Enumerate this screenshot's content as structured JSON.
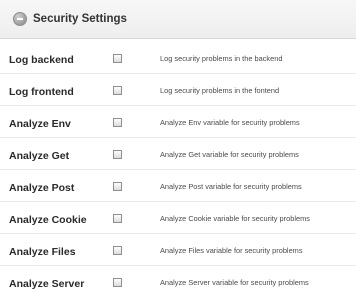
{
  "panel": {
    "title": "Security Settings",
    "toggle_icon": "minus-circle-icon"
  },
  "settings": [
    {
      "label": "Log backend",
      "checked": false,
      "description": "Log security problems in the backend"
    },
    {
      "label": "Log frontend",
      "checked": false,
      "description": "Log security problems in the fontend"
    },
    {
      "label": "Analyze Env",
      "checked": false,
      "description": "Analyze Env variable for security problems"
    },
    {
      "label": "Analyze Get",
      "checked": false,
      "description": "Analyze Get variable for security problems"
    },
    {
      "label": "Analyze Post",
      "checked": false,
      "description": "Analyze Post variable for security problems"
    },
    {
      "label": "Analyze Cookie",
      "checked": false,
      "description": "Analyze Cookie variable for security problems"
    },
    {
      "label": "Analyze Files",
      "checked": false,
      "description": "Analyze Files variable for security problems"
    },
    {
      "label": "Analyze Server",
      "checked": false,
      "description": "Analyze Server variable for security problems"
    }
  ]
}
